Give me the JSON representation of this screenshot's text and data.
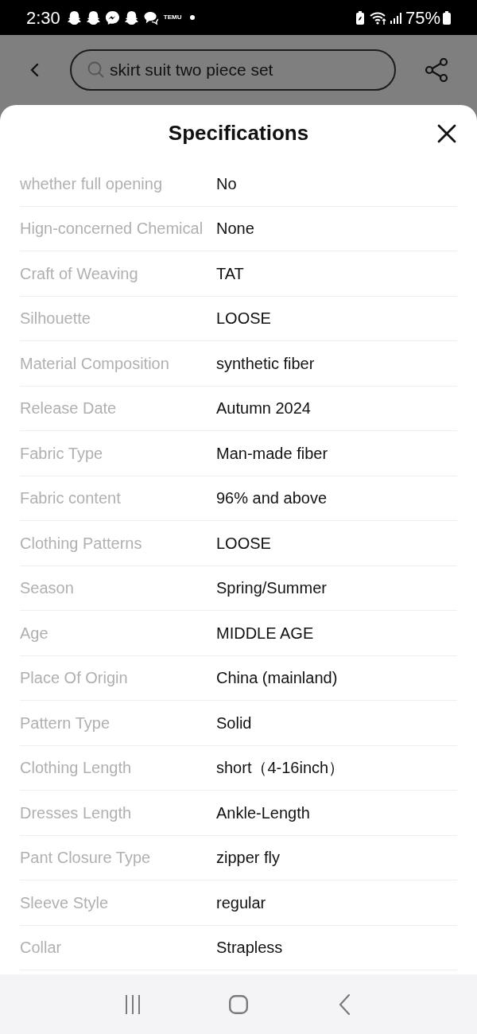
{
  "status_bar": {
    "time": "2:30",
    "notification_label": "TEMU",
    "battery": "75%"
  },
  "search_bar": {
    "query": "skirt suit two piece set"
  },
  "sheet": {
    "title": "Specifications",
    "rows": [
      {
        "label": "whether full opening",
        "value": "No"
      },
      {
        "label": "Hign-concerned Chemical",
        "value": "None"
      },
      {
        "label": "Craft of Weaving",
        "value": "TAT"
      },
      {
        "label": "Silhouette",
        "value": "LOOSE"
      },
      {
        "label": "Material Composition",
        "value": "synthetic fiber"
      },
      {
        "label": "Release Date",
        "value": "Autumn 2024"
      },
      {
        "label": "Fabric Type",
        "value": "Man-made fiber"
      },
      {
        "label": "Fabric content",
        "value": "96% and above"
      },
      {
        "label": "Clothing Patterns",
        "value": "LOOSE"
      },
      {
        "label": "Season",
        "value": "Spring/Summer"
      },
      {
        "label": "Age",
        "value": "MIDDLE AGE"
      },
      {
        "label": "Place Of Origin",
        "value": "China (mainland)"
      },
      {
        "label": "Pattern Type",
        "value": "Solid"
      },
      {
        "label": "Clothing Length",
        "value": "short（4-16inch）"
      },
      {
        "label": "Dresses Length",
        "value": "Ankle-Length"
      },
      {
        "label": "Pant Closure Type",
        "value": "zipper fly"
      },
      {
        "label": "Sleeve Style",
        "value": "regular"
      },
      {
        "label": "Collar",
        "value": "Strapless"
      }
    ]
  }
}
